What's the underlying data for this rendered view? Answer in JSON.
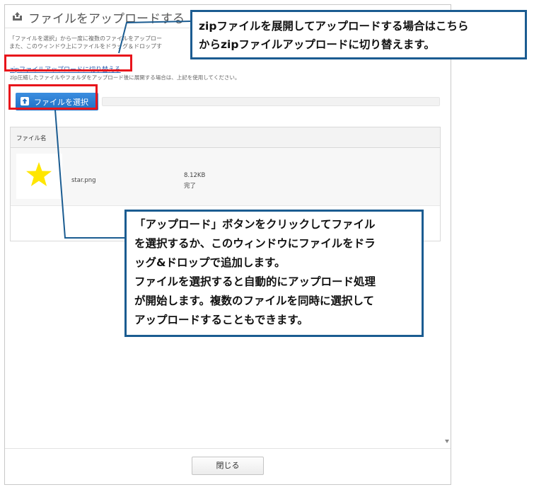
{
  "dialog": {
    "title": "ファイルをアップロードする",
    "description": [
      "「ファイルを選択」から一度に複数のファイルをアップロー",
      "また、このウィンドウ上にファイルをドラッグ＆ドロップす"
    ],
    "zip_link": "zipファイルアップロードに切り替える",
    "zip_note": "zip圧縮したファイルやフォルダをアップロード後に展開する場合は、上記を使用してください。",
    "select_button": "ファイルを選択",
    "table": {
      "header": "ファイル名",
      "rows": [
        {
          "name": "star.png",
          "size": "8.12KB",
          "status": "完了"
        }
      ]
    },
    "close_button": "閉じる"
  },
  "callouts": {
    "zip": [
      "zipファイルを展開してアップロードする場合はこちら",
      "からzipファイルアップロードに切り替えます。"
    ],
    "upload": [
      "「アップロード」ボタンをクリックしてファイル",
      "を選択するか、このウィンドウにファイルをドラ",
      "ッグ&ドロップで追加します。",
      "ファイルを選択すると自動的にアップロード処理",
      "が開始します。複数のファイルを同時に選択して",
      "アップロードすることもできます。"
    ]
  },
  "colors": {
    "highlight_red": "#e8141b",
    "callout_border": "#1b5c91",
    "button_blue": "#1f6fc4",
    "star_yellow": "#ffe600"
  },
  "icons": [
    "upload-tray-icon",
    "upload-icon",
    "star-thumbnail",
    "scroll-down-icon"
  ]
}
